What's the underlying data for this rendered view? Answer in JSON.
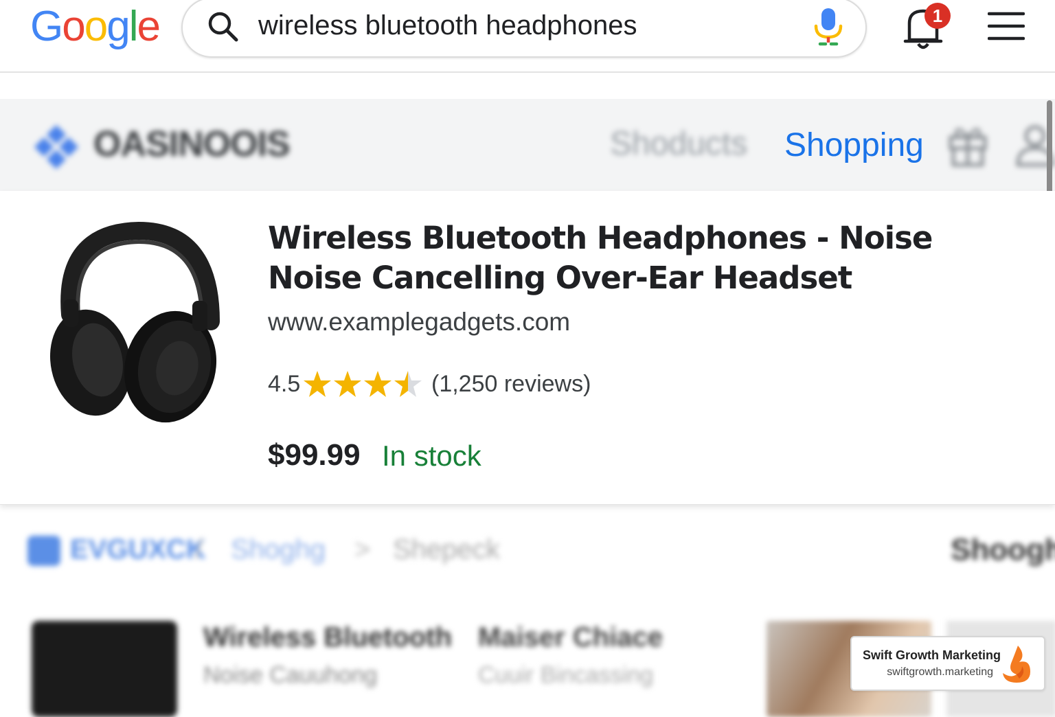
{
  "header": {
    "logo": {
      "letters": [
        "G",
        "o",
        "o",
        "g",
        "l",
        "e"
      ],
      "colors": [
        "#4285F4",
        "#EA4335",
        "#FBBC05",
        "#4285F4",
        "#34A853",
        "#EA4335"
      ]
    },
    "search": {
      "value": "wireless bluetooth headphones",
      "icon": "search-icon"
    },
    "mic_icon": "mic-icon",
    "notifications": {
      "icon": "bell-icon",
      "count": "1"
    },
    "menu_icon": "hamburger-menu-icon"
  },
  "site_nav": {
    "brand": "OASINOOIS",
    "items": [
      "Shoducts",
      "Shopping"
    ],
    "active_item": "Shopping",
    "icons": [
      "gift-icon",
      "account-icon"
    ]
  },
  "product": {
    "title": "Wireless Bluetooth Headphones - Noise Noise Cancelling Over-Ear Headset",
    "url": "www.examplegadgets.com",
    "rating": 4.5,
    "rating_text": "4.5",
    "reviews_text": "(1,250 reviews)",
    "price": "$99.99",
    "availability": "In stock",
    "colors": {
      "star": "#F4B400",
      "in_stock": "#188038",
      "link": "#1a73e8"
    }
  },
  "breadcrumbs": {
    "items": [
      "EVGUXCK",
      "Shoghg",
      "Shepeck"
    ],
    "right_label": "Shoogh"
  },
  "related": [
    {
      "title": "Wireless Bluetooth",
      "subtitle": "Noise Cauuhong"
    },
    {
      "title": "Maiser Chiace",
      "subtitle": "Cuuir Bincassing"
    }
  ],
  "watermark": {
    "name": "Swift Growth Marketing",
    "url": "swiftgrowth.marketing"
  }
}
